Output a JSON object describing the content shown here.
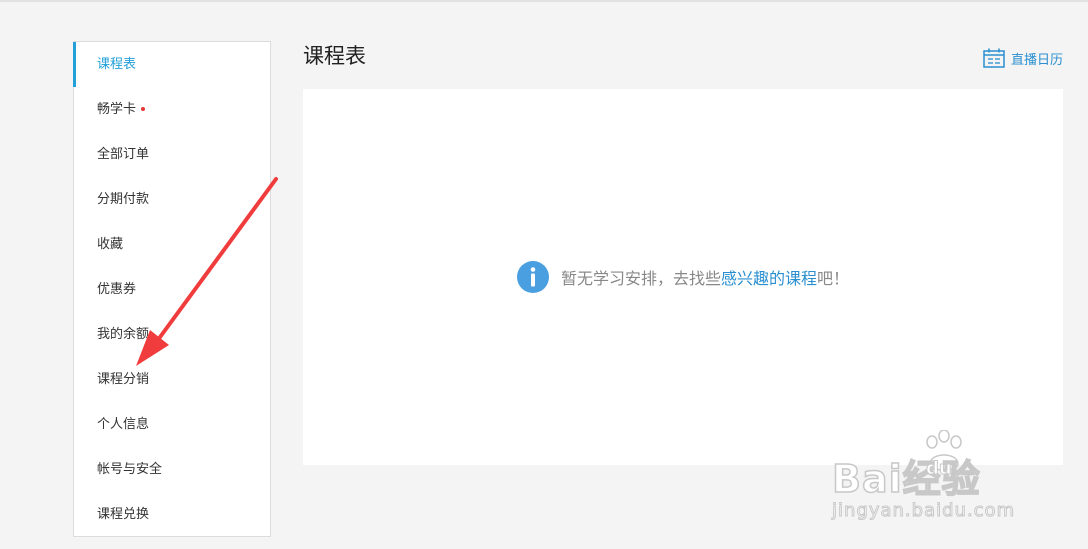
{
  "sidebar": {
    "items": [
      {
        "label": "课程表",
        "active": true
      },
      {
        "label": "畅学卡",
        "dot": true
      },
      {
        "label": "全部订单"
      },
      {
        "label": "分期付款"
      },
      {
        "label": "收藏"
      },
      {
        "label": "优惠券"
      },
      {
        "label": "我的余额"
      },
      {
        "label": "课程分销"
      },
      {
        "label": "个人信息"
      },
      {
        "label": "帐号与安全"
      },
      {
        "label": "课程兑换"
      }
    ]
  },
  "main": {
    "title": "课程表",
    "calendar_link": "直播日历",
    "empty": {
      "prefix": "暂无学习安排，去找些",
      "link": "感兴趣的课程",
      "suffix": "吧！"
    }
  },
  "watermark": {
    "brand": "Bai经验",
    "brand_du": "du",
    "url": "jingyan.baidu.com"
  },
  "colors": {
    "accent": "#23a0d9",
    "link": "#2a8fd0",
    "badge": "#e53935",
    "arrow": "#f03c3c"
  }
}
